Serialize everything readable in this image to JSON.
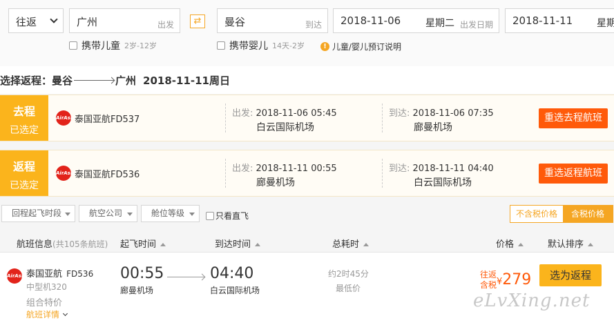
{
  "search": {
    "trip_type": "往返",
    "from_city": "广州",
    "from_hint": "出发",
    "to_city": "曼谷",
    "to_hint": "到达",
    "depart_date": "2018-11-06",
    "depart_weekday": "星期二",
    "depart_hint": "出发日期",
    "return_date": "2018-11-11",
    "return_weekday": "星期",
    "swap_icon": "swap-arrows-icon",
    "options": {
      "child_label": "携带儿童",
      "child_age": "2岁-12岁",
      "infant_label": "携带婴儿",
      "infant_age": "14天-2岁",
      "booking_note": "儿童/婴儿预订说明"
    }
  },
  "heading": {
    "prefix": "选择返程：曼谷",
    "dest": "广州",
    "date": "2018-11-11周日"
  },
  "legs": [
    {
      "tag_top": "去程",
      "tag_bottom": "已选定",
      "airline": "泰国亚航FD537",
      "dep_label": "出发:",
      "dep_time": "2018-11-06 05:45",
      "dep_airport": "白云国际机场",
      "arr_label": "到达:",
      "arr_time": "2018-11-06 07:35",
      "arr_airport": "廊曼机场",
      "button": "重选去程航班"
    },
    {
      "tag_top": "返程",
      "tag_bottom": "已选定",
      "airline": "泰国亚航FD536",
      "dep_label": "出发:",
      "dep_time": "2018-11-11 00:55",
      "dep_airport": "廊曼机场",
      "arr_label": "到达:",
      "arr_time": "2018-11-11 04:40",
      "arr_airport": "白云国际机场",
      "button": "重选返程航班"
    }
  ],
  "filters": {
    "return_time": "回程起飞时段",
    "airline": "航空公司",
    "cabin": "舱位等级",
    "direct_only": "只看直飞",
    "price_excl_tax": "不含税价格",
    "price_incl_tax": "含税价格"
  },
  "table_header": {
    "flight_info": "航班信息",
    "flight_count": "(共105条航班)",
    "dep_time": "起飞时间",
    "arr_time": "到达时间",
    "duration": "总耗时",
    "price": "价格",
    "sort": "默认排序"
  },
  "flight": {
    "airline": "泰国亚航",
    "flight_no": "FD536",
    "aircraft": "中型机320",
    "fare_type": "组合特价",
    "detail_link": "航班详情",
    "dep_time": "00:55",
    "dep_airport": "廊曼机场",
    "arr_time": "04:40",
    "arr_airport": "白云国际机场",
    "duration": "约2时45分",
    "lowest": "最低价",
    "price_line1": "往返",
    "price_line2": "含税",
    "currency": "¥",
    "price": "279",
    "select_button": "选为返程"
  },
  "logo_text": "AirAsia",
  "watermark": "eLvXing.net",
  "colors": {
    "accent": "#fbb41c",
    "action": "#ff5a0a",
    "airline_red": "#e2231a"
  }
}
